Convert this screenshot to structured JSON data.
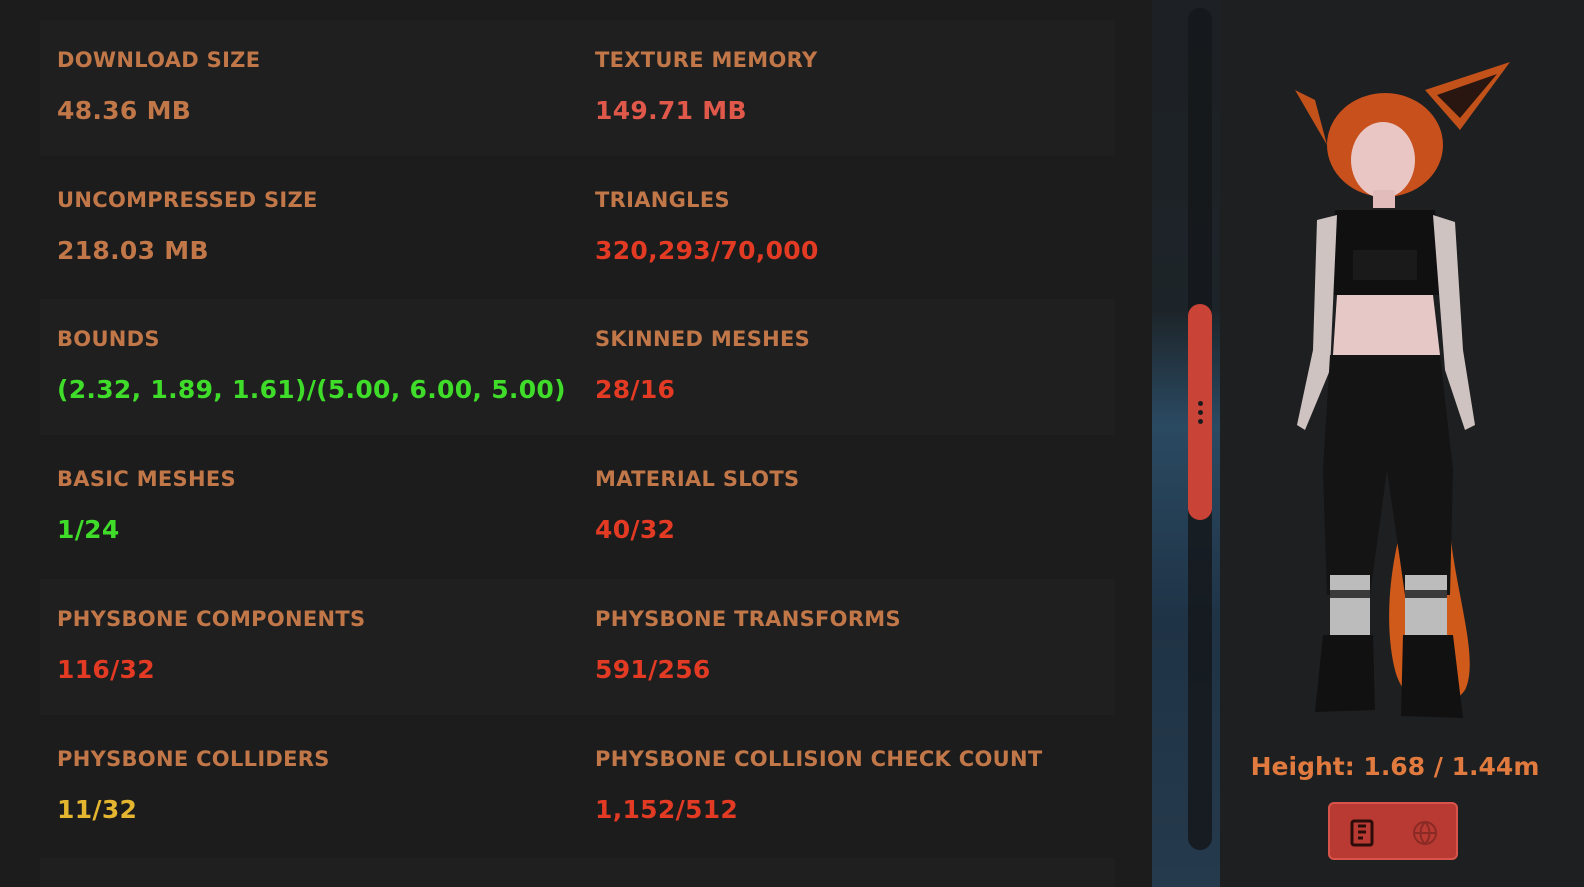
{
  "stats": [
    {
      "left": {
        "label": "DOWNLOAD SIZE",
        "value": "48.36 MB",
        "color": "#c27748"
      },
      "right": {
        "label": "TEXTURE MEMORY",
        "value": "149.71 MB",
        "color": "#e0584a"
      }
    },
    {
      "left": {
        "label": "UNCOMPRESSED SIZE",
        "value": "218.03 MB",
        "color": "#c27748"
      },
      "right": {
        "label": "TRIANGLES",
        "value": "320,293/70,000",
        "color": "#e33a24"
      }
    },
    {
      "left": {
        "label": "BOUNDS",
        "value": "(2.32, 1.89, 1.61)/(5.00, 6.00, 5.00)",
        "color": "#3fdd2a"
      },
      "right": {
        "label": "SKINNED MESHES",
        "value": "28/16",
        "color": "#e33a24"
      }
    },
    {
      "left": {
        "label": "BASIC MESHES",
        "value": "1/24",
        "color": "#3fdd2a"
      },
      "right": {
        "label": "MATERIAL SLOTS",
        "value": "40/32",
        "color": "#e33a24"
      }
    },
    {
      "left": {
        "label": "PHYSBONE COMPONENTS",
        "value": "116/32",
        "color": "#e33a24"
      },
      "right": {
        "label": "PHYSBONE TRANSFORMS",
        "value": "591/256",
        "color": "#e33a24"
      }
    },
    {
      "left": {
        "label": "PHYSBONE COLLIDERS",
        "value": "11/32",
        "color": "#e4b630"
      },
      "right": {
        "label": "PHYSBONE COLLISION CHECK COUNT",
        "value": "1,152/512",
        "color": "#e33a24"
      }
    }
  ],
  "preview": {
    "height_text": "Height: 1.68 / 1.44m"
  },
  "icons": {
    "drag_handle": "drag-handle-icon",
    "action_primary": "document-badge-icon",
    "action_secondary": "globe-icon"
  }
}
